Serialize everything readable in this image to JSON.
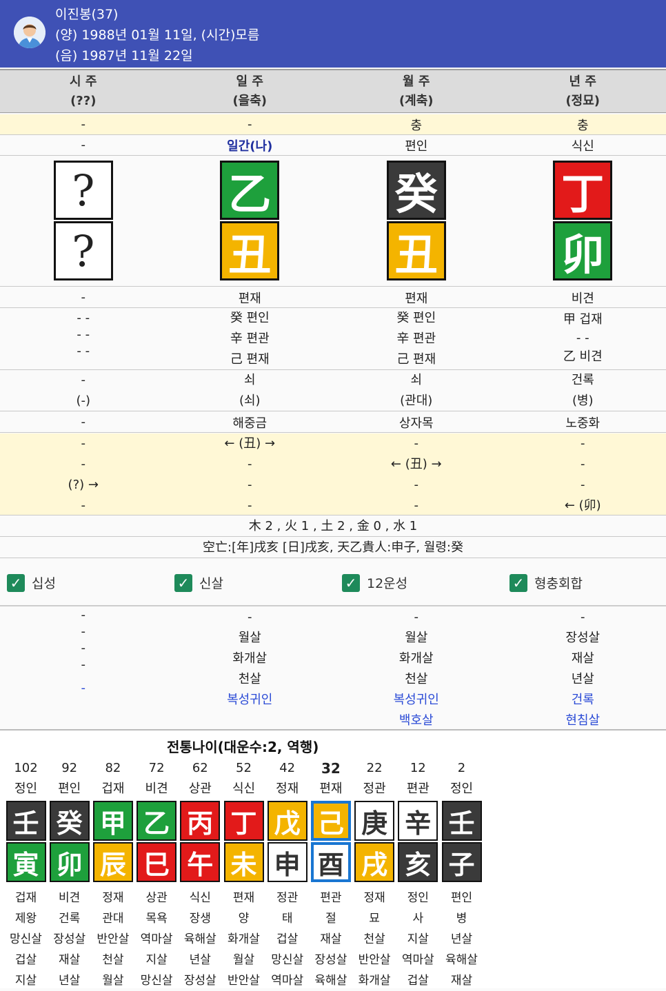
{
  "profile": {
    "name": "이진봉(37)",
    "solar": "(양) 1988년 01월 11일, (시간)모름",
    "lunar": "(음) 1987년 11월 22일"
  },
  "pillars": [
    {
      "title": "시 주",
      "sub": "(??)",
      "clash": "-",
      "ten_stem": "-",
      "stem": "?",
      "stem_color": "white",
      "branch": "?",
      "branch_color": "white",
      "ten_branch": "-",
      "hidden": [
        "- -",
        "- -",
        "- -"
      ],
      "unseong": "-",
      "unseong2": "(-)",
      "napeum": "-",
      "rel": [
        "-",
        "-",
        "(?) →",
        "-"
      ],
      "sinsal": [
        "-",
        "-",
        "-",
        "-",
        "-"
      ]
    },
    {
      "title": "일 주",
      "sub": "(을축)",
      "clash": "-",
      "ten_stem": "일간(나)",
      "stem": "乙",
      "stem_color": "green",
      "branch": "丑",
      "branch_color": "yellow",
      "ten_branch": "편재",
      "hidden": [
        "癸 편인",
        "辛 편관",
        "己 편재"
      ],
      "unseong": "쇠",
      "unseong2": "(쇠)",
      "napeum": "해중금",
      "rel": [
        "← (丑) →",
        "-",
        "-",
        "-"
      ],
      "sinsal": [
        "-",
        "월살",
        "화개살",
        "천살",
        "복성귀인"
      ]
    },
    {
      "title": "월 주",
      "sub": "(계축)",
      "clash": "충",
      "ten_stem": "편인",
      "stem": "癸",
      "stem_color": "black",
      "branch": "丑",
      "branch_color": "yellow",
      "ten_branch": "편재",
      "hidden": [
        "癸 편인",
        "辛 편관",
        "己 편재"
      ],
      "unseong": "쇠",
      "unseong2": "(관대)",
      "napeum": "상자목",
      "rel": [
        "-",
        "← (丑) →",
        "-",
        "-"
      ],
      "sinsal": [
        "-",
        "월살",
        "화개살",
        "천살",
        "복성귀인",
        "백호살"
      ]
    },
    {
      "title": "년 주",
      "sub": "(정묘)",
      "clash": "충",
      "ten_stem": "식신",
      "stem": "丁",
      "stem_color": "red",
      "branch": "卯",
      "branch_color": "green",
      "ten_branch": "비견",
      "hidden": [
        "甲 겁재",
        "- -",
        "乙 비견"
      ],
      "unseong": "건록",
      "unseong2": "(병)",
      "napeum": "노중화",
      "rel": [
        "-",
        "-",
        "-",
        "← (卯)"
      ],
      "sinsal": [
        "-",
        "장성살",
        "재살",
        "년살",
        "건록",
        "현침살"
      ]
    }
  ],
  "elements_line": "木 2 , 火 1 , 土 2 , 金 0 , 水 1",
  "gongmang_line": "空亡:[年]戌亥 [日]戌亥, 天乙貴人:申子, 월령:癸",
  "checkboxes": [
    "십성",
    "신살",
    "12운성",
    "형충회합"
  ],
  "daeun": {
    "title": "전통나이(대운수:2, 역행)",
    "columns": [
      {
        "age": "102",
        "ten_top": "정인",
        "stem": "壬",
        "sc": "black",
        "branch": "寅",
        "bc": "green",
        "ten_bottom": "겁재",
        "unseong": "제왕",
        "s1": "망신살",
        "s2": "겁살",
        "s3": "지살"
      },
      {
        "age": "92",
        "ten_top": "편인",
        "stem": "癸",
        "sc": "black",
        "branch": "卯",
        "bc": "green",
        "ten_bottom": "비견",
        "unseong": "건록",
        "s1": "장성살",
        "s2": "재살",
        "s3": "년살"
      },
      {
        "age": "82",
        "ten_top": "겁재",
        "stem": "甲",
        "sc": "green",
        "branch": "辰",
        "bc": "yellow",
        "ten_bottom": "정재",
        "unseong": "관대",
        "s1": "반안살",
        "s2": "천살",
        "s3": "월살"
      },
      {
        "age": "72",
        "ten_top": "비견",
        "stem": "乙",
        "sc": "green",
        "branch": "巳",
        "bc": "red",
        "ten_bottom": "상관",
        "unseong": "목욕",
        "s1": "역마살",
        "s2": "지살",
        "s3": "망신살"
      },
      {
        "age": "62",
        "ten_top": "상관",
        "stem": "丙",
        "sc": "red",
        "branch": "午",
        "bc": "red",
        "ten_bottom": "식신",
        "unseong": "장생",
        "s1": "육해살",
        "s2": "년살",
        "s3": "장성살"
      },
      {
        "age": "52",
        "ten_top": "식신",
        "stem": "丁",
        "sc": "red",
        "branch": "未",
        "bc": "yellow",
        "ten_bottom": "편재",
        "unseong": "양",
        "s1": "화개살",
        "s2": "월살",
        "s3": "반안살"
      },
      {
        "age": "42",
        "ten_top": "정재",
        "stem": "戊",
        "sc": "yellow",
        "branch": "申",
        "bc": "white",
        "ten_bottom": "정관",
        "unseong": "태",
        "s1": "겁살",
        "s2": "망신살",
        "s3": "역마살"
      },
      {
        "age": "32",
        "ten_top": "편재",
        "stem": "己",
        "sc": "yellow",
        "branch": "酉",
        "bc": "white",
        "ten_bottom": "편관",
        "unseong": "절",
        "s1": "재살",
        "s2": "장성살",
        "s3": "육해살",
        "selected": true
      },
      {
        "age": "22",
        "ten_top": "정관",
        "stem": "庚",
        "sc": "white",
        "branch": "戌",
        "bc": "yellow",
        "ten_bottom": "정재",
        "unseong": "묘",
        "s1": "천살",
        "s2": "반안살",
        "s3": "화개살"
      },
      {
        "age": "12",
        "ten_top": "편관",
        "stem": "辛",
        "sc": "white",
        "branch": "亥",
        "bc": "black",
        "ten_bottom": "정인",
        "unseong": "사",
        "s1": "지살",
        "s2": "역마살",
        "s3": "겁살"
      },
      {
        "age": "2",
        "ten_top": "정인",
        "stem": "壬",
        "sc": "black",
        "branch": "子",
        "bc": "black",
        "ten_bottom": "편인",
        "unseong": "병",
        "s1": "년살",
        "s2": "육해살",
        "s3": "재살"
      }
    ]
  },
  "colors": {
    "header": "#3f51b5",
    "wood": "#1ea03c",
    "fire": "#e21a1a",
    "earth": "#f4b400",
    "water": "#3a3a3a",
    "metal": "#ffffff",
    "selected": "#1976d2"
  }
}
